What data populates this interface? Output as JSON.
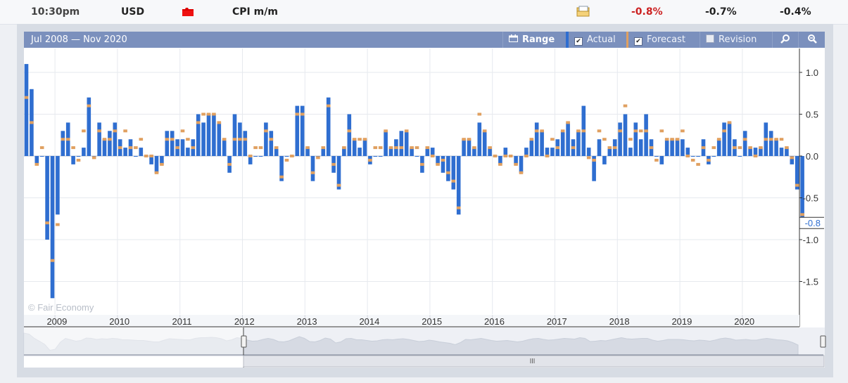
{
  "header": {
    "time": "10:30pm",
    "currency": "USD",
    "impact_icon": "high-impact-folder-icon",
    "impact_color": "#dd0000",
    "event": "CPI m/m",
    "detail_icon": "detail-folder-icon",
    "actual": "-0.8%",
    "forecast": "-0.7%",
    "previous": "-0.4%",
    "actual_color": "#cc2222"
  },
  "toolbar": {
    "range_text": "Jul 2008 — Nov 2020",
    "range_label": "Range",
    "range_icon": "calendar-icon",
    "actual_label": "Actual",
    "actual_checked": true,
    "forecast_label": "Forecast",
    "forecast_checked": true,
    "revision_label": "Revision",
    "revision_checked": false,
    "zoom_in_icon": "zoom-in-icon",
    "zoom_out_icon": "zoom-out-icon"
  },
  "watermark": "© Fair Economy",
  "last_value_label": "-0.8",
  "colors": {
    "actual": "#2f6ed0",
    "forecast": "#e0a060",
    "grid": "#e6e9ee",
    "zero": "#b9c3d3"
  },
  "chart_data": {
    "type": "bar",
    "ylim": [
      -1.7,
      1.1
    ],
    "yticks": [
      1.0,
      0.5,
      0.0,
      -0.5,
      -1.0,
      -1.5
    ],
    "ytick_labels": [
      "1.0",
      "0.5",
      "0.0",
      "-0.5",
      "-1.0",
      "-1.5"
    ],
    "year_labels": [
      "2009",
      "2010",
      "2011",
      "2012",
      "2013",
      "2014",
      "2015",
      "2016",
      "2017",
      "2018",
      "2019",
      "2020"
    ],
    "grid": true,
    "start": "2008-07",
    "series": [
      {
        "name": "Actual",
        "values": [
          1.1,
          0.8,
          -0.1,
          0.0,
          -1.0,
          -1.7,
          -0.7,
          0.3,
          0.4,
          -0.1,
          0.0,
          0.1,
          0.7,
          0.0,
          0.4,
          0.2,
          0.3,
          0.4,
          0.2,
          0.1,
          0.2,
          0.0,
          0.1,
          0.0,
          -0.1,
          -0.2,
          -0.1,
          0.3,
          0.3,
          0.2,
          0.2,
          0.1,
          0.2,
          0.5,
          0.4,
          0.5,
          0.5,
          0.4,
          0.2,
          -0.2,
          0.5,
          0.4,
          0.3,
          -0.1,
          0.0,
          0.0,
          0.4,
          0.3,
          0.1,
          -0.3,
          0.0,
          0.0,
          0.6,
          0.6,
          0.1,
          -0.3,
          0.0,
          0.1,
          0.7,
          -0.2,
          -0.4,
          0.1,
          0.5,
          0.2,
          0.1,
          0.2,
          -0.1,
          0.0,
          0.0,
          0.3,
          0.1,
          0.2,
          0.3,
          0.3,
          0.1,
          0.0,
          -0.2,
          0.1,
          0.1,
          -0.1,
          -0.2,
          -0.3,
          -0.4,
          -0.7,
          0.2,
          0.2,
          0.1,
          0.4,
          0.3,
          0.1,
          0.0,
          -0.1,
          0.1,
          0.0,
          -0.1,
          -0.2,
          0.1,
          0.2,
          0.4,
          0.3,
          0.1,
          0.1,
          0.2,
          0.3,
          0.4,
          0.2,
          0.3,
          0.6,
          0.1,
          -0.3,
          0.2,
          -0.1,
          0.1,
          0.2,
          0.4,
          0.5,
          0.1,
          0.4,
          0.2,
          0.5,
          0.2,
          0.0,
          -0.1,
          0.2,
          0.2,
          0.2,
          0.2,
          0.1,
          0.0,
          0.0,
          0.2,
          -0.1,
          0.0,
          0.2,
          0.4,
          0.4,
          0.2,
          0.0,
          0.3,
          0.1,
          0.1,
          0.1,
          0.4,
          0.3,
          0.2,
          0.1,
          0.1,
          -0.1,
          -0.4,
          -0.8
        ],
        "color": "#2f6ed0"
      },
      {
        "name": "Forecast",
        "values": [
          0.7,
          0.4,
          -0.1,
          0.1,
          -0.8,
          -1.25,
          -0.82,
          0.2,
          0.2,
          0.1,
          -0.05,
          0.3,
          0.6,
          -0.02,
          0.3,
          0.2,
          0.2,
          0.3,
          0.1,
          0.3,
          0.1,
          0.1,
          0.2,
          0.0,
          0.0,
          -0.2,
          -0.1,
          0.2,
          0.2,
          0.1,
          0.3,
          0.2,
          0.1,
          0.4,
          0.5,
          0.5,
          0.5,
          0.4,
          0.2,
          -0.1,
          0.2,
          0.2,
          0.2,
          0.0,
          0.1,
          0.1,
          0.3,
          0.2,
          0.1,
          -0.25,
          -0.05,
          0.0,
          0.5,
          0.5,
          0.1,
          -0.2,
          -0.02,
          0.1,
          0.6,
          -0.1,
          -0.35,
          0.1,
          0.3,
          0.2,
          0.2,
          0.2,
          -0.05,
          0.1,
          0.1,
          0.3,
          0.1,
          0.1,
          0.1,
          0.3,
          0.1,
          0.1,
          -0.1,
          0.1,
          0.0,
          -0.1,
          -0.05,
          -0.2,
          -0.3,
          -0.62,
          0.2,
          0.2,
          0.1,
          0.5,
          0.3,
          0.1,
          0.0,
          -0.1,
          0.0,
          0.0,
          -0.1,
          -0.2,
          0.0,
          0.2,
          0.3,
          0.3,
          0.0,
          0.2,
          0.1,
          0.3,
          0.4,
          0.1,
          0.3,
          0.3,
          -0.02,
          -0.05,
          0.3,
          0.2,
          0.1,
          0.1,
          0.3,
          0.6,
          0.2,
          0.3,
          0.3,
          0.3,
          0.1,
          -0.05,
          0.3,
          0.2,
          0.2,
          0.2,
          0.3,
          0.0,
          -0.05,
          -0.1,
          0.1,
          -0.05,
          0.1,
          0.2,
          0.3,
          0.4,
          0.1,
          0.1,
          0.2,
          0.1,
          0.0,
          0.1,
          0.2,
          0.2,
          0.2,
          0.2,
          0.1,
          -0.02,
          -0.35,
          -0.7
        ],
        "color": "#e0a060"
      }
    ]
  }
}
